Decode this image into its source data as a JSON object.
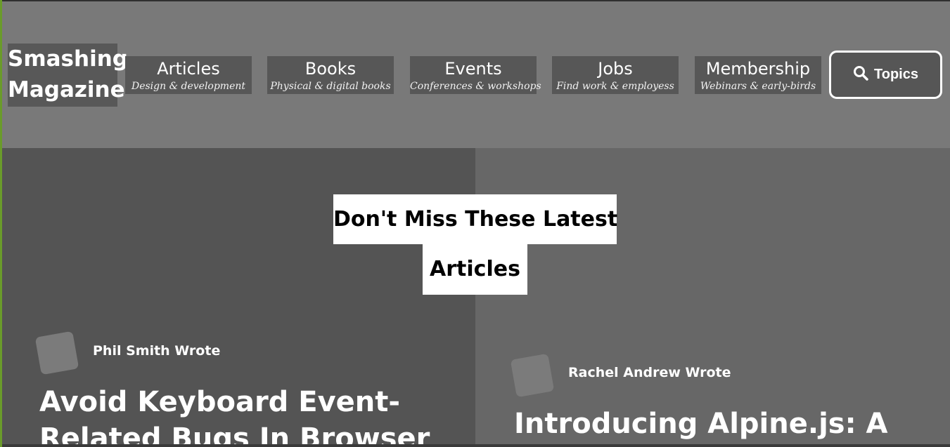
{
  "header": {
    "logo_text": "Smashing\nMagazine",
    "nav": [
      {
        "title": "Articles",
        "subtitle": "Design & development"
      },
      {
        "title": "Books",
        "subtitle": "Physical & digital books"
      },
      {
        "title": "Events",
        "subtitle": "Conferences & workshops"
      },
      {
        "title": "Jobs",
        "subtitle": "Find work & employess"
      },
      {
        "title": "Membership",
        "subtitle": "Webinars & early-birds"
      }
    ],
    "topics_label": "Topics",
    "topics_icon": "search-icon"
  },
  "section": {
    "heading_line1": "Don't Miss These Latest",
    "heading_line2": "Articles"
  },
  "articles": [
    {
      "author": "Phil Smith Wrote",
      "title_line1": "Avoid Keyboard Event-",
      "title_line2": "Related Bugs In Browser"
    },
    {
      "author": "Rachel Andrew Wrote",
      "title_line1": "Introducing Alpine.js: A"
    }
  ],
  "colors": {
    "accent_edge": "#6a9b2a",
    "header_bg": "#797979",
    "nav_bg": "#575757"
  }
}
